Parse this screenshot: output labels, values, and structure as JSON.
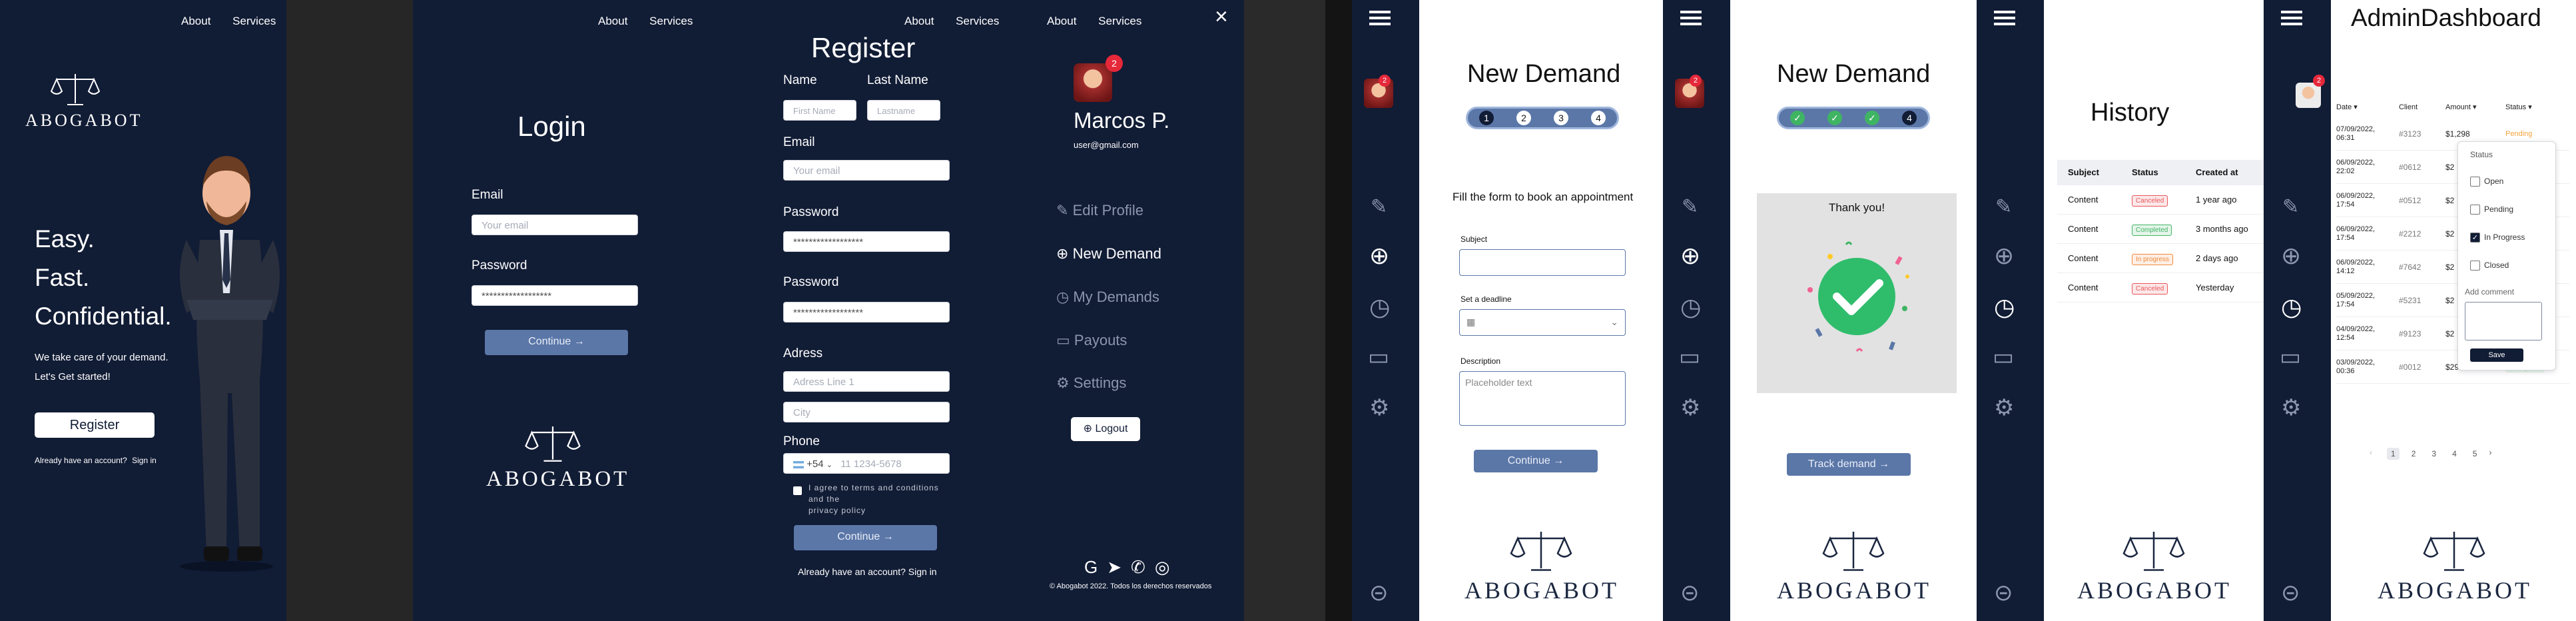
{
  "nav": {
    "about": "About",
    "services": "Services"
  },
  "brand": {
    "name": "ABOGABOT"
  },
  "landing": {
    "line1": "Easy.",
    "line2": "Fast.",
    "line3": "Confidential.",
    "tagline1": "We take care of your demand.",
    "tagline2": "Let's Get started!",
    "register_button": "Register",
    "account_prompt": "Already have an account?",
    "signin": "Sign in"
  },
  "login": {
    "title": "Login",
    "email_label": "Email",
    "email_placeholder": "Your email",
    "password_label": "Password",
    "password_value": "******************",
    "continue": "Continue →"
  },
  "register": {
    "title": "Register",
    "name_label": "Name",
    "lastname_label": "Last Name",
    "firstname_placeholder": "First Name",
    "lastname_placeholder": "Lastname",
    "email_label": "Email",
    "email_placeholder": "Your email",
    "password_label": "Password",
    "password_value": "******************",
    "password2_label": "Password",
    "password2_value": "******************",
    "address_label": "Adress",
    "address1_placeholder": "Adress Line 1",
    "city_placeholder": "City",
    "phone_label": "Phone",
    "phone_code": "+54",
    "phone_placeholder": "11  1234-5678",
    "terms_line1": "I agree to terms and conditions",
    "terms_line2": "and the",
    "terms_line3": "privacy policy",
    "continue": "Continue →",
    "account_prompt": "Already have an account?",
    "signin": "Sign in"
  },
  "menu": {
    "badge": "2",
    "user_name": "Marcos P.",
    "user_email": "user@gmail.com",
    "items": [
      "Edit Profile",
      "New Demand",
      "My Demands",
      "Payouts",
      "Settings"
    ],
    "logout": "Logout",
    "footer": "© Abogabot 2022. Todos los derechos reservados"
  },
  "demand1": {
    "title": "New Demand",
    "steps": [
      "1",
      "2",
      "3",
      "4"
    ],
    "intro": "Fill the form to book an appointment",
    "subject_label": "Subject",
    "deadline_label": "Set a deadline",
    "description_label": "Description",
    "description_placeholder": "Placeholder text",
    "continue": "Continue →"
  },
  "demand2": {
    "title": "New Demand",
    "step_last": "4",
    "thanks": "Thank you!",
    "track": "Track demand →"
  },
  "history": {
    "title": "History",
    "headers": [
      "Subject",
      "Status",
      "Created at"
    ],
    "rows": [
      {
        "subject": "Content",
        "status": "Canceled",
        "created": "1 year ago",
        "color": "#e9555a"
      },
      {
        "subject": "Content",
        "status": "Completed",
        "created": "3 months ago",
        "color": "#3fb463"
      },
      {
        "subject": "Content",
        "status": "In progress",
        "created": "2 days ago",
        "color": "#f28a3c"
      },
      {
        "subject": "Content",
        "status": "Canceled",
        "created": "Yesterday",
        "color": "#e9555a"
      }
    ]
  },
  "admin": {
    "title": "AdminDashboard",
    "headers": [
      "Date ▾",
      "Client",
      "Amount ▾",
      "Status ▾"
    ],
    "rows": [
      {
        "date1": "07/09/2022,",
        "date2": "06:31",
        "client": "#3123",
        "amount": "$1,298",
        "status": "Pending"
      },
      {
        "date1": "06/09/2022,",
        "date2": "22:02",
        "client": "#0612",
        "amount": "$2",
        "status": ""
      },
      {
        "date1": "06/09/2022,",
        "date2": "17:54",
        "client": "#0512",
        "amount": "$2",
        "status": ""
      },
      {
        "date1": "06/09/2022,",
        "date2": "17:54",
        "client": "#2212",
        "amount": "$2",
        "status": ""
      },
      {
        "date1": "06/09/2022,",
        "date2": "14:12",
        "client": "#7642",
        "amount": "$2",
        "status": ""
      },
      {
        "date1": "05/09/2022,",
        "date2": "17:54",
        "client": "#5231",
        "amount": "$2",
        "status": ""
      },
      {
        "date1": "04/09/2022,",
        "date2": "12:54",
        "client": "#9123",
        "amount": "$2",
        "status": ""
      },
      {
        "date1": "03/09/2022,",
        "date2": "00:36",
        "client": "#0012",
        "amount": "$299.60",
        "status": "Complete"
      }
    ],
    "filter": {
      "title": "Status",
      "options": [
        "Open",
        "Pending",
        "In Progress",
        "Closed"
      ],
      "comment_label": "Add comment",
      "save": "Save"
    },
    "pages": [
      "1",
      "2",
      "3",
      "4",
      "5"
    ],
    "prev": "‹",
    "next": "›"
  }
}
